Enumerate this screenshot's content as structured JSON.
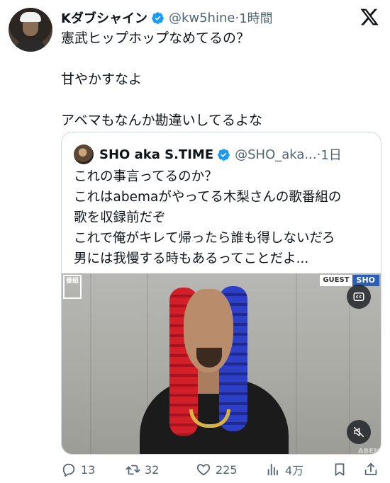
{
  "author": {
    "display_name": "Kダブシャイン",
    "handle": "@kw5hine",
    "time": "1時間",
    "separator": "·"
  },
  "tweet": {
    "lines": [
      "憲武ヒップホップなめてるの？",
      "甘やかすなよ",
      "アベマもなんか勘違いしてるよな"
    ]
  },
  "quote": {
    "display_name": "SHO aka S.TIME",
    "handle": "@SHO_aka...",
    "time": "1日",
    "separator": "·",
    "lines": [
      "これの事言ってるのか？",
      "これはabemaがやってる木梨さんの歌番組の",
      "歌を収録前だぞ",
      "これで俺がキレて帰ったら誰も得しないだろ",
      "男には我慢する時もあるってことだよ..."
    ],
    "video": {
      "corner_logo": "番組",
      "guest_label": "GUEST",
      "guest_name": "SHO",
      "watermark": "ABEM"
    }
  },
  "actions": {
    "replies": "13",
    "reposts": "32",
    "likes": "225",
    "views": "4万"
  },
  "colors": {
    "text": "#0f1419",
    "secondary": "#536471",
    "verified": "#1d9bf0",
    "border": "#cfd9de"
  }
}
